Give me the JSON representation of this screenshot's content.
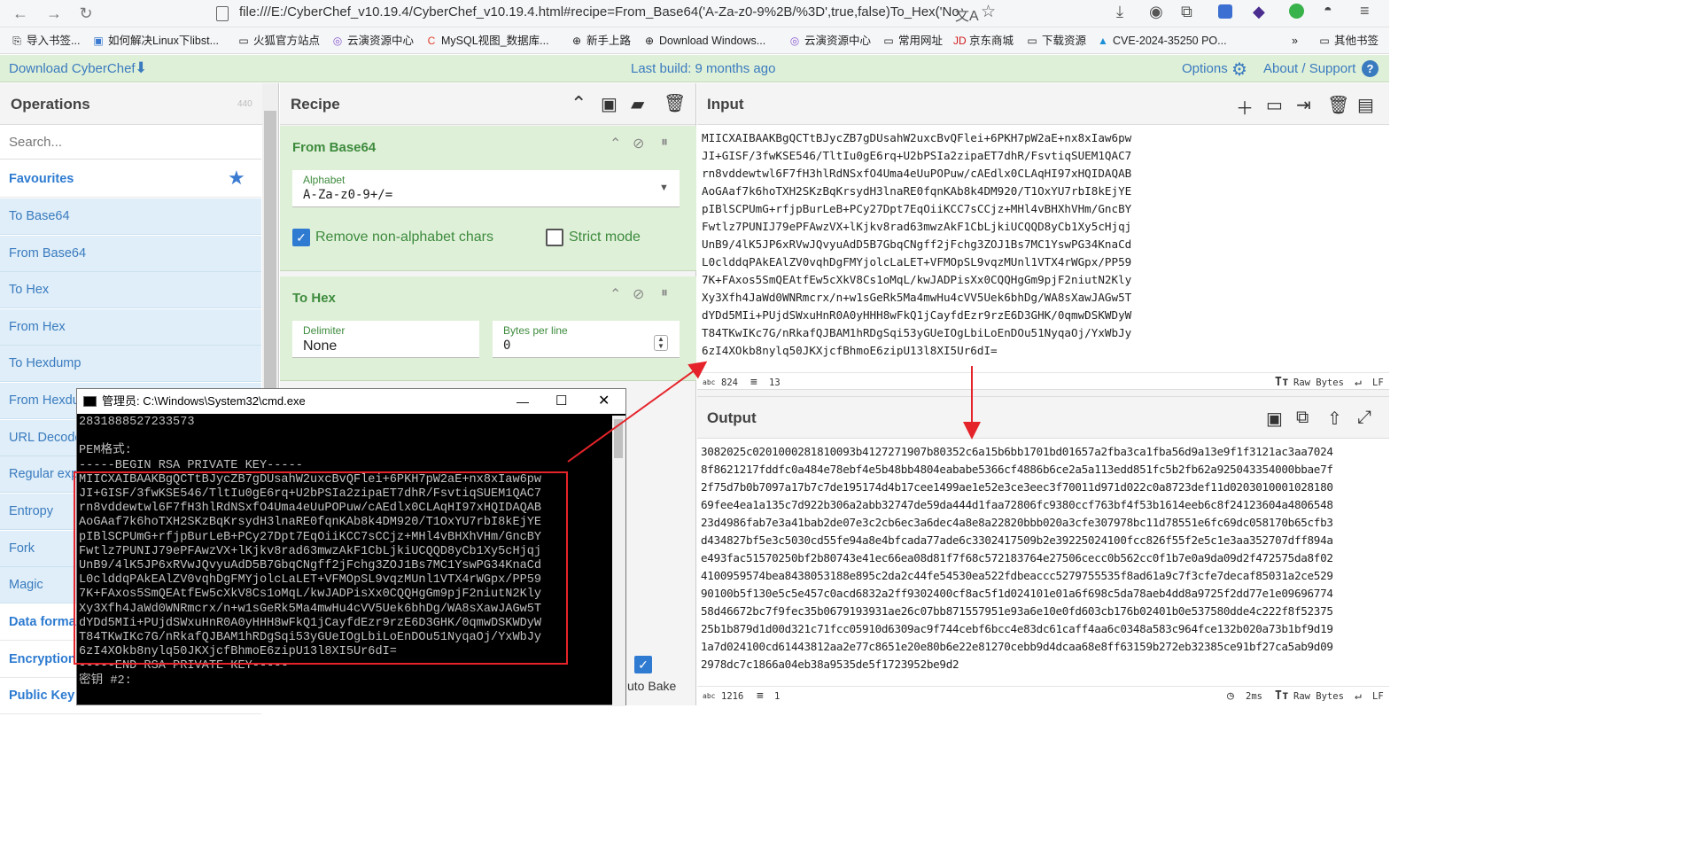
{
  "browser": {
    "address": "file:///E:/CyberChef_v10.19.4/CyberChef_v10.19.4.html#recipe=From_Base64('A-Za-z0-9%2B/%3D',true,false)To_Hex('No",
    "bookmarks": [
      "导入书签...",
      "如何解决Linux下libst...",
      "火狐官方站点",
      "云演资源中心",
      "MySQL视图_数据库...",
      "新手上路",
      "Download Windows...",
      "云演资源中心",
      "常用网址",
      "京东商城",
      "下载资源",
      "CVE-2024-35250 PO...",
      "其他书签"
    ]
  },
  "banner": {
    "download": "Download CyberChef",
    "last_build": "Last build: 9 months ago",
    "options": "Options",
    "about": "About / Support"
  },
  "operations": {
    "title": "Operations",
    "count": "440",
    "search_placeholder": "Search...",
    "items": [
      "Favourites",
      "To Base64",
      "From Base64",
      "To Hex",
      "From Hex",
      "To Hexdump",
      "From Hexdu",
      "URL Decode",
      "Regular exp",
      "Entropy",
      "Fork",
      "Magic",
      "Data forma",
      "Encryption",
      "Public Key"
    ]
  },
  "recipe": {
    "title": "Recipe",
    "from_base64": {
      "title": "From Base64",
      "alphabet_label": "Alphabet",
      "alphabet_value": "A-Za-z0-9+/=",
      "remove_label": "Remove non-alphabet chars",
      "strict_label": "Strict mode"
    },
    "to_hex": {
      "title": "To Hex",
      "delimiter_label": "Delimiter",
      "delimiter_value": "None",
      "bpl_label": "Bytes per line",
      "bpl_value": "0"
    },
    "autobake_label": "uto Bake"
  },
  "input": {
    "title": "Input",
    "text": "MIICXAIBAAKBgQCTtBJycZB7gDUsahW2uxcBvQFlei+6PKH7pW2aE+nx8xIaw6pw\nJI+GISF/3fwKSE546/TltIu0gE6rq+U2bPSIa2zipaET7dhR/FsvtiqSUEM1QAC7\nrn8vddewtwl6F7fH3hlRdNSxfO4Uma4eUuPOPuw/cAEdlx0CLAqHI97xHQIDAQAB\nAoGAaf7k6hoTXH2SKzBqKrsydH3lnaRE0fqnKAb8k4DM920/T1OxYU7rbI8kEjYE\npIBlSCPUmG+rfjpBurLeB+PCy27Dpt7EqOiiKCC7sCCjz+MHl4vBHXhVHm/GncBY\nFwtlz7PUNIJ79ePFAwzVX+lKjkv8rad63mwzAkF1CbLjkiUCQQD8yCb1Xy5cHjqj\nUnB9/4lK5JP6xRVwJQvyuAdD5B7GbqCNgff2jFchg3ZOJ1Bs7MC1YswPG34KnaCd\nL0clddqPAkEAlZV0vqhDgFMYjolcLaLET+VFMOpSL9vqzMUnl1VTX4rWGpx/PP59\n7K+FAxos5SmQEAtfEw5cXkV8Cs1oMqL/kwJADPisXx0CQQHgGm9pjF2niutN2Kly\nXy3Xfh4JaWd0WNRmcrx/n+w1sGeRk5Ma4mwHu4cVV5Uek6bhDg/WA8sXawJAGw5T\ndYDd5MIi+PUjdSWxuHnR0A0yHHH8wFkQ1jCayfdEzr9rzE6D3GHK/0qmwDSKWDyW\nT84TKwIKc7G/nRkafQJBAM1hRDgSqi53yGUeIOgLbiLoEnDOu51NyqaOj/YxWbJy\n6zI4XOkb8nylq50JKXjcfBhmoE6zipU13l8XI5Ur6dI=",
    "length": "824",
    "lines": "13"
  },
  "output": {
    "title": "Output",
    "text": "3082025c0201000281810093b4127271907b80352c6a15b6bb1701bd01657a2fba3ca1fba56d9a13e9f1f3121ac3aa7024\n8f8621217fddfc0a484e78ebf4e5b48bb4804eababe5366cf4886b6ce2a5a113edd851fc5b2fb62a925043354000bbae7f\n2f75d7b0b7097a17b7c7de195174d4b17cee1499ae1e52e3ce3eec3f70011d971d022c0a8723def11d0203010001028180\n69fee4ea1a135c7d922b306a2abb32747de59da444d1faa72806fc9380ccf763bf4f53b1614eeb6c8f24123604a4806548\n23d4986fab7e3a41bab2de07e3c2cb6ec3a6dec4a8e8a22820bbb020a3cfe307978bc11d78551e6fc69dc058170b65cfb3\nd434827bf5e3c5030cd55fe94a8e4bfcada77ade6c3302417509b2e39225024100fcc826f55f2e5c1e3aa352707dff894a\ne493fac51570250bf2b80743e41ec66ea08d81f7f68c572183764e27506cecc0b562cc0f1b7e0a9da09d2f472575da8f02\n4100959574bea8438053188e895c2da2c44fe54530ea522fdbeaccc5279755535f8ad61a9c7f3cfe7decaf85031a2ce529\n90100b5f130e5c5e457c0acd6832a2ff9302400cf8ac5f1d024101e01a6f698c5da78aeb4dd8a9725f2dd77e1e09696774\n58d46672bc7f9fec35b0679193931ae26c07bb871557951e93a6e10e0fd603cb176b02401b0e537580dde4c222f8f52375\n25b1b879d1d00d321c71fcc05910d6309ac9f744cebf6bcc4e83dc61caff4aa6c0348a583c964fce132b020a73b1bf9d19\n1a7d024100cd61443812aa2e77c8651e20e80b6e22e81270cebb9d4dcaa68e8ff63159b272eb32385ce91bf27ca5ab9d09\n2978dc7c1866a04eb38a9535de5f1723952be9d2",
    "length": "1216",
    "lines": "1",
    "time": "2ms"
  },
  "status": {
    "raw_bytes": "Raw Bytes",
    "eol": "LF"
  },
  "cmd": {
    "title": "管理员: C:\\Windows\\System32\\cmd.exe",
    "text": "2831888527233573\n\nPEM格式:\n-----BEGIN RSA PRIVATE KEY-----\nMIICXAIBAAKBgQCTtBJycZB7gDUsahW2uxcBvQFlei+6PKH7pW2aE+nx8xIaw6pw\nJI+GISF/3fwKSE546/TltIu0gE6rq+U2bPSIa2zipaET7dhR/FsvtiqSUEM1QAC7\nrn8vddewtwl6F7fH3hlRdNSxfO4Uma4eUuPOPuw/cAEdlx0CLAqHI97xHQIDAQAB\nAoGAaf7k6hoTXH2SKzBqKrsydH3lnaRE0fqnKAb8k4DM920/T1OxYU7rbI8kEjYE\npIBlSCPUmG+rfjpBurLeB+PCy27Dpt7EqOiiKCC7sCCjz+MHl4vBHXhVHm/GncBY\nFwtlz7PUNIJ79ePFAwzVX+lKjkv8rad63mwzAkF1CbLjkiUCQQD8yCb1Xy5cHjqj\nUnB9/4lK5JP6xRVwJQvyuAdD5B7GbqCNgff2jFchg3ZOJ1Bs7MC1YswPG34KnaCd\nL0clddqPAkEAlZV0vqhDgFMYjolcLaLET+VFMOpSL9vqzMUnl1VTX4rWGpx/PP59\n7K+FAxos5SmQEAtfEw5cXkV8Cs1oMqL/kwJADPisXx0CQQHgGm9pjF2niutN2Kly\nXy3Xfh4JaWd0WNRmcrx/n+w1sGeRk5Ma4mwHu4cVV5Uek6bhDg/WA8sXawJAGw5T\ndYDd5MIi+PUjdSWxuHnR0A0yHHH8wFkQ1jCayfdEzr9rzE6D3GHK/0qmwDSKWDyW\nT84TKwIKc7G/nRkafQJBAM1hRDgSqi53yGUeIOgLbiLoEnDOu51NyqaOj/YxWbJy\n6zI4XOkb8nylq50JKXjcfBhmoE6zipU13l8XI5Ur6dI=\n-----END RSA PRIVATE KEY-----\n密钥 #2:"
  },
  "colors": {
    "banner_green": "#dff0d8",
    "link_blue": "#3a7bbf",
    "annotation_red": "#e5232a"
  }
}
